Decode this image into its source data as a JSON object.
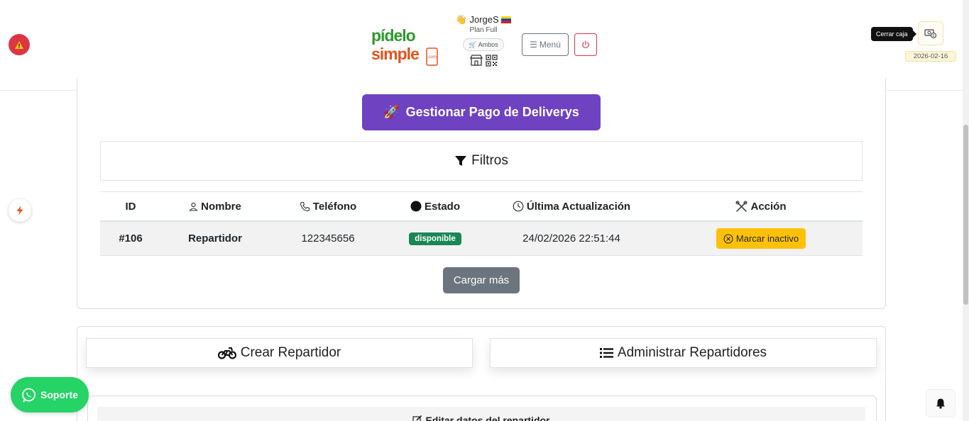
{
  "header": {
    "user": {
      "name": "JorgeS",
      "plan": "Plan Full",
      "mode": "Ambos"
    },
    "menu_label": "Menú",
    "tooltip": "Cerrar caja",
    "date": "2026-02-16"
  },
  "main": {
    "deliverys_button": "Gestionar Pago de Deliverys",
    "filters_title": "Filtros",
    "table": {
      "headers": {
        "id": "ID",
        "name": "Nombre",
        "phone": "Teléfono",
        "status": "Estado",
        "updated": "Última Actualización",
        "action": "Acción"
      },
      "rows": [
        {
          "id": "#106",
          "name": "Repartidor",
          "phone": "122345656",
          "status": "disponible",
          "updated": "24/02/2026 22:51:44",
          "action": "Marcar inactivo"
        }
      ]
    },
    "load_more": "Cargar más"
  },
  "bottom": {
    "tabs": {
      "create": "Crear Repartidor",
      "admin": "Administrar Repartidores"
    },
    "edit_header": "Editar datos del repartidor"
  },
  "floating": {
    "support": "Soporte"
  },
  "colors": {
    "accent_purple": "#6f42c1",
    "success": "#198754",
    "warning": "#ffc107",
    "danger": "#dc3545",
    "whatsapp": "#25d366",
    "secondary": "#6c757d"
  },
  "icons": {
    "alert": "warning-triangle-icon",
    "bolt": "lightning-icon",
    "rocket": "rocket-icon",
    "filter": "funnel-icon",
    "bell": "bell-icon",
    "whatsapp": "whatsapp-icon"
  }
}
